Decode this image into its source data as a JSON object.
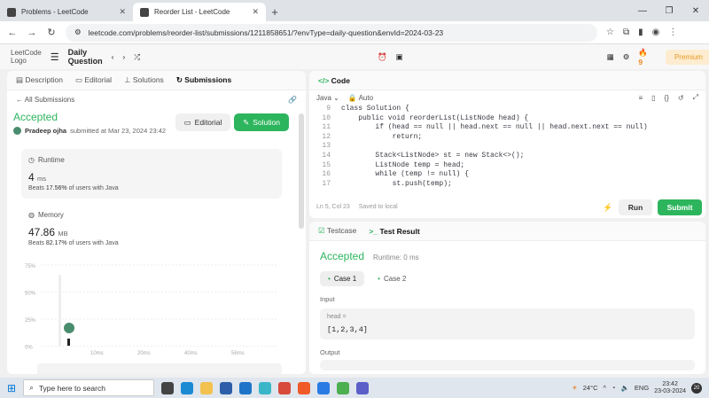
{
  "browser": {
    "tabs": [
      {
        "title": "Problems - LeetCode",
        "close": "✕"
      },
      {
        "title": "Reorder List - LeetCode",
        "close": "✕"
      }
    ],
    "new_tab": "+",
    "window_controls": [
      "—",
      "❐",
      "✕"
    ],
    "url": "leetcode.com/problems/reorder-list/submissions/1211858651/?envType=daily-question&envId=2024-03-23"
  },
  "header": {
    "logo_alt": "LeetCode Logo",
    "daily_question": "Daily Question",
    "streak": "9",
    "premium": "Premium"
  },
  "left": {
    "tabs": [
      "Description",
      "Editorial",
      "Solutions",
      "Submissions"
    ],
    "back": "All Submissions",
    "status": "Accepted",
    "user": "Pradeep ojha",
    "submitted": "submitted at Mar 23, 2024 23:42",
    "editorial_btn": "Editorial",
    "solution_btn": "Solution",
    "runtime": {
      "label": "Runtime",
      "value": "4",
      "unit": "ms",
      "beats_pre": "Beats",
      "beats": "17.56%",
      "beats_post": "of users with Java"
    },
    "memory": {
      "label": "Memory",
      "value": "47.86",
      "unit": "MB",
      "beats_pre": "Beats",
      "beats": "82.17%",
      "beats_post": "of users with Java"
    }
  },
  "chart_data": {
    "type": "bar",
    "y_ticks": [
      "75%",
      "50%",
      "25%",
      "0%"
    ],
    "x_ticks": [
      "10ms",
      "20ms",
      "40ms",
      "56ms"
    ],
    "grid": true,
    "user_marker_x": "4ms"
  },
  "code": {
    "title": "Code",
    "language": "Java",
    "auto": "Auto",
    "lines": [
      {
        "n": "9",
        "t": "class Solution {"
      },
      {
        "n": "10",
        "t": "    public void reorderList(ListNode head) {"
      },
      {
        "n": "11",
        "t": "        if (head == null || head.next == null || head.next.next == null)"
      },
      {
        "n": "12",
        "t": "            return;"
      },
      {
        "n": "13",
        "t": ""
      },
      {
        "n": "14",
        "t": "        Stack<ListNode> st = new Stack<>();"
      },
      {
        "n": "15",
        "t": "        ListNode temp = head;"
      },
      {
        "n": "16",
        "t": "        while (temp != null) {"
      },
      {
        "n": "17",
        "t": "            st.push(temp);"
      }
    ],
    "cursor": "Ln 5, Col 23",
    "saved": "Saved to local",
    "run": "Run",
    "submit": "Submit"
  },
  "result": {
    "tabs": [
      "Testcase",
      "Test Result"
    ],
    "status": "Accepted",
    "runtime": "Runtime: 0 ms",
    "cases": [
      "Case 1",
      "Case 2"
    ],
    "input_label": "Input",
    "var": "head =",
    "value": "[1,2,3,4]",
    "output_label": "Output"
  },
  "taskbar": {
    "search": "Type here to search",
    "temp": "24°C",
    "lang": "ENG",
    "time": "23:42",
    "date": "23-03-2024",
    "notif": "20"
  }
}
